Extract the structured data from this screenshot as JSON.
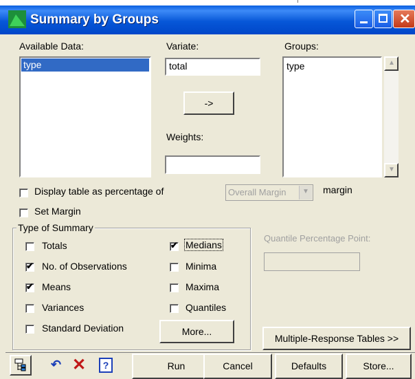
{
  "window": {
    "title": "Summary by Groups"
  },
  "lists": {
    "available_label": "Available Data:",
    "available_items": [
      "type"
    ],
    "variate_label": "Variate:",
    "variate_value": "total",
    "move_button": "->",
    "weights_label": "Weights:",
    "weights_value": "",
    "groups_label": "Groups:",
    "groups_items": [
      "type"
    ]
  },
  "percentage": {
    "display_label": "Display table as percentage of",
    "margin_select": "Overall Margin",
    "margin_suffix": "margin",
    "set_margin_label": "Set Margin"
  },
  "summary": {
    "title": "Type of Summary",
    "options": [
      {
        "label": "Totals",
        "checked": false
      },
      {
        "label": "No. of Observations",
        "checked": true
      },
      {
        "label": "Means",
        "checked": true
      },
      {
        "label": "Variances",
        "checked": false
      },
      {
        "label": "Standard Deviation",
        "checked": false
      },
      {
        "label": "Medians",
        "checked": true
      },
      {
        "label": "Minima",
        "checked": false
      },
      {
        "label": "Maxima",
        "checked": false
      },
      {
        "label": "Quantiles",
        "checked": false
      }
    ],
    "more_button": "More..."
  },
  "quantile": {
    "label": "Quantile Percentage Point:",
    "value": ""
  },
  "multi_button": "Multiple-Response Tables >>",
  "footer": {
    "run": "Run",
    "cancel": "Cancel",
    "defaults": "Defaults",
    "store": "Store..."
  },
  "colors": {
    "title_bar": "#0757d8",
    "face": "#ece9d8",
    "selection": "#316ac5"
  }
}
